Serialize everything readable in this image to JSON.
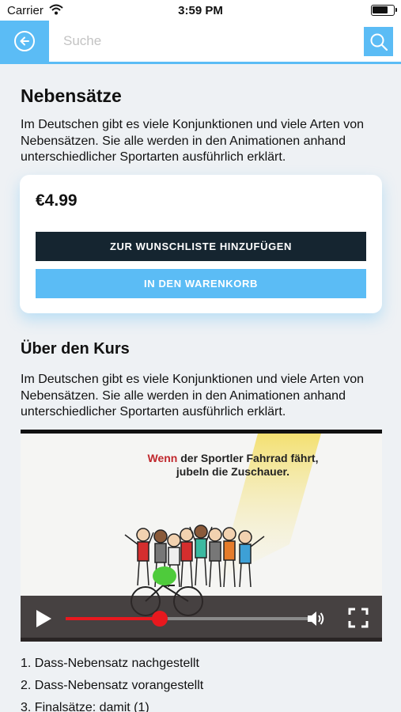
{
  "status_bar": {
    "carrier": "Carrier",
    "time": "3:59 PM"
  },
  "header": {
    "search_placeholder": "Suche",
    "back_icon": "back-arrow-circle-icon",
    "search_icon": "magnifier-icon"
  },
  "product": {
    "title": "Nebensätze",
    "description": "Im Deutschen gibt es viele Konjunktionen und viele Arten von Nebensätzen. Sie alle werden in den Animationen anhand unterschiedlicher Sportarten ausführlich erklärt.",
    "price": "€4.99",
    "wishlist_label": "ZUR WUNSCHLISTE HINZUFÜGEN",
    "cart_label": "IN DEN WARENKORB"
  },
  "course": {
    "section_title": "Über den Kurs",
    "description": "Im Deutschen gibt es viele Konjunktionen und viele Arten von Nebensätzen. Sie alle werden in den Animationen anhand unterschiedlicher Sportarten ausführlich erklärt.",
    "video": {
      "caption_highlight": "Wenn",
      "caption_rest": " der Sportler Fahrrad fährt,",
      "caption_line2": "jubeln die Zuschauer.",
      "progress": 0.38
    },
    "lessons": [
      "1. Dass-Nebensatz nachgestellt",
      "2. Dass-Nebensatz vorangestellt",
      "3. Finalsätze: damit (1)"
    ]
  },
  "colors": {
    "accent": "#5bbcf5",
    "dark": "#152530",
    "progress_red": "#e8181e"
  }
}
